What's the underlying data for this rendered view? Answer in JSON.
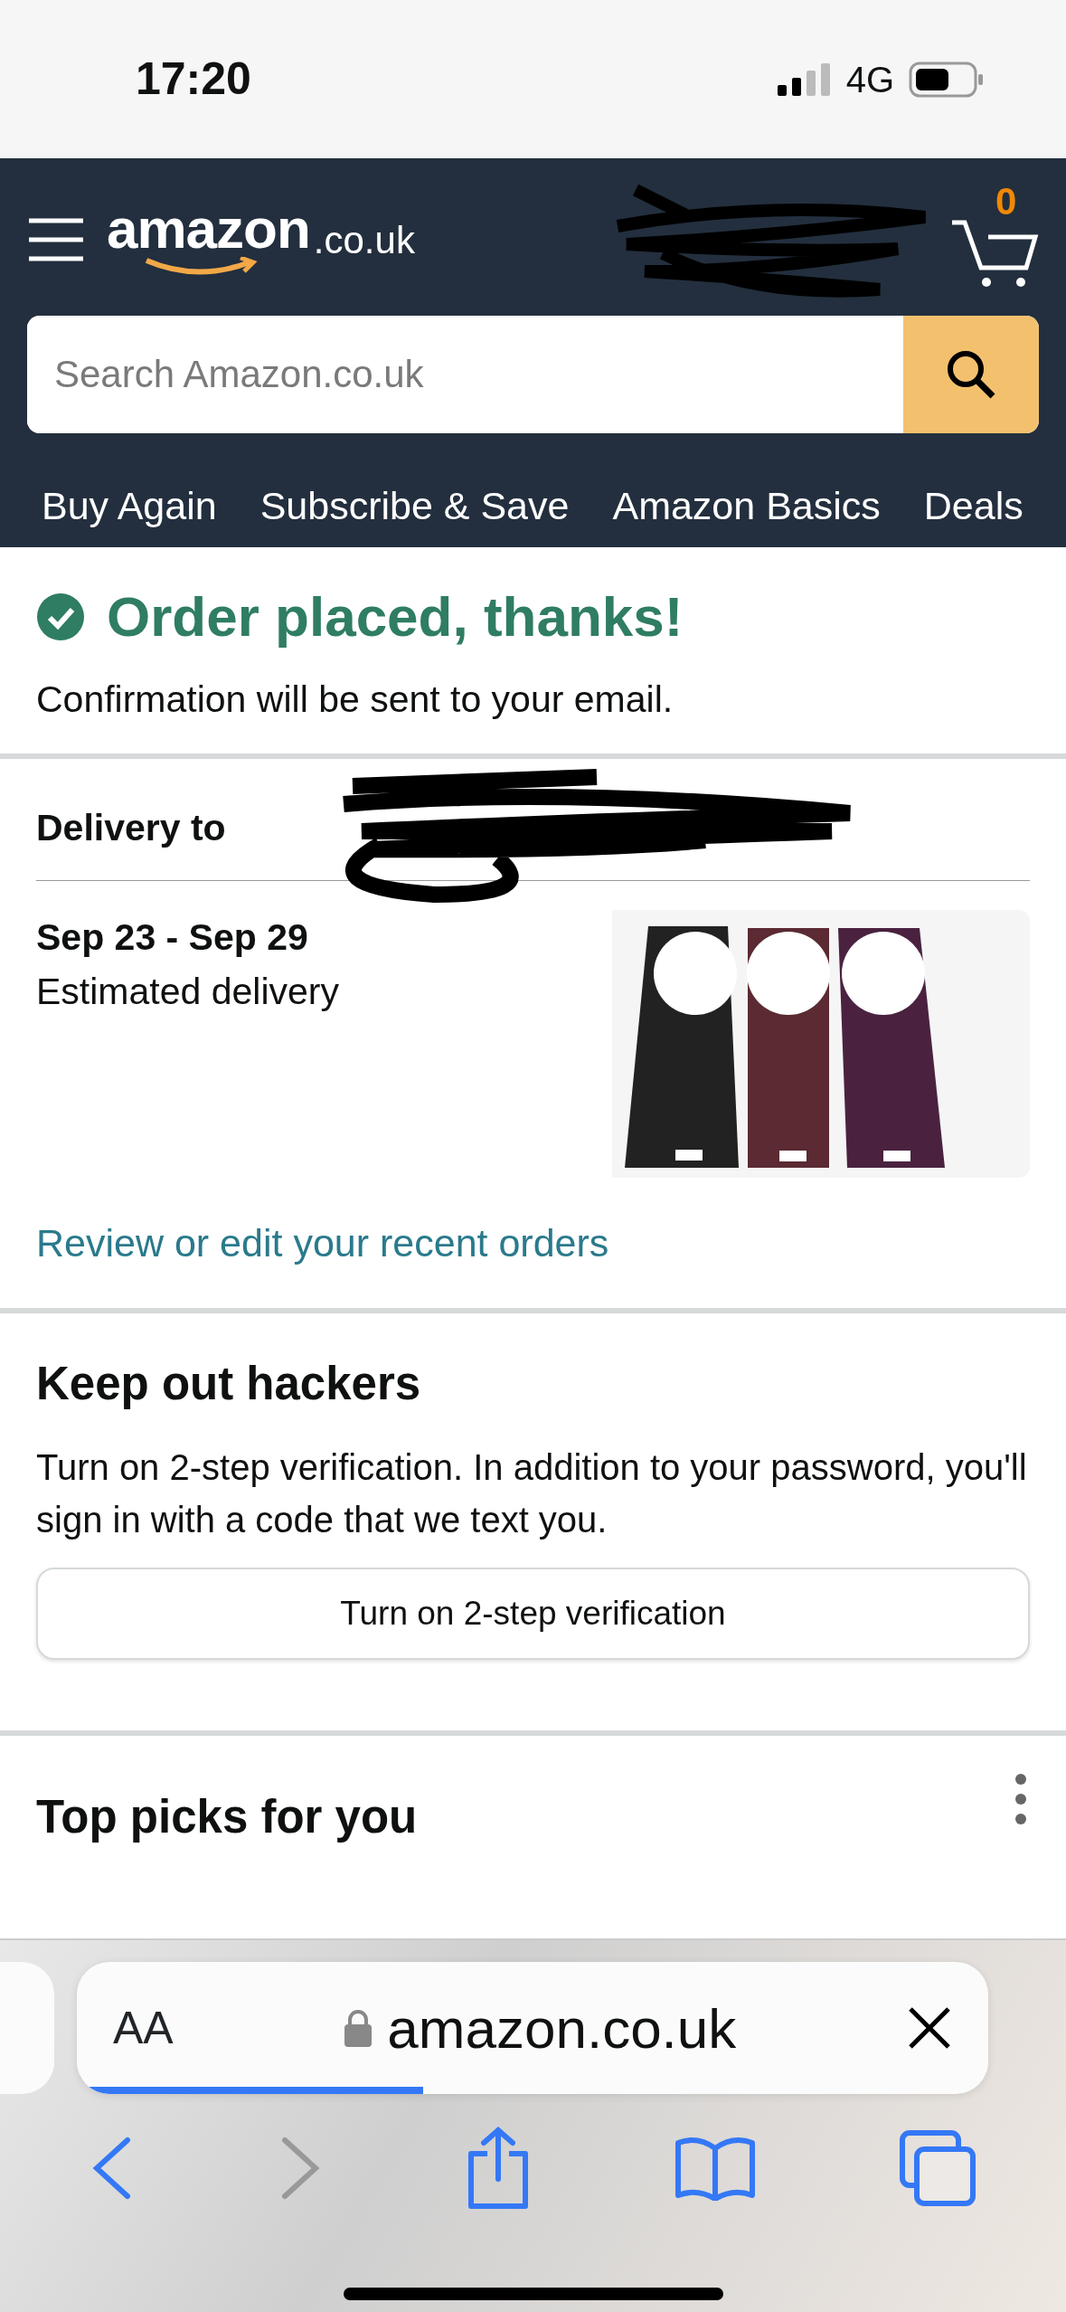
{
  "status_bar": {
    "time": "17:20",
    "network": "4G"
  },
  "header": {
    "logo_word": "amazon",
    "logo_suffix": ".co.uk",
    "cart_count": "0",
    "search": {
      "placeholder": "Search Amazon.co.uk"
    },
    "nav": [
      {
        "label": "Buy Again"
      },
      {
        "label": "Subscribe & Save"
      },
      {
        "label": "Amazon Basics"
      },
      {
        "label": "Deals"
      }
    ]
  },
  "confirmation": {
    "title": "Order placed, thanks!",
    "message": "Confirmation will be sent to your email."
  },
  "delivery": {
    "label": "Delivery to",
    "dates": "Sep 23 - Sep 29",
    "estimate": "Estimated delivery",
    "link": "Review or edit your recent orders"
  },
  "security": {
    "title": "Keep out hackers",
    "text": "Turn on 2-step verification. In addition to your password, you'll sign in with a code that we text you.",
    "button": "Turn on 2-step verification"
  },
  "top_picks": {
    "title": "Top picks for you"
  },
  "browser": {
    "text_size": "AA",
    "url": "amazon.co.uk",
    "load": {
      "level": 0.38
    }
  }
}
